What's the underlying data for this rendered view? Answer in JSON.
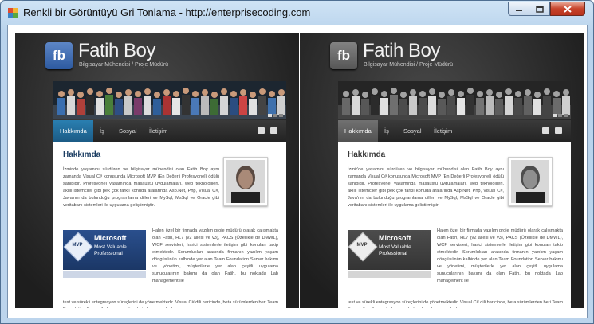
{
  "window": {
    "title": "Renkli bir Görüntüyü Gri Tonlama - http://enterprisecoding.com",
    "controls": [
      "minimize",
      "maximize",
      "close"
    ]
  },
  "page": {
    "logo_text": "fb",
    "site_title": "Fatih Boy",
    "site_subtitle": "Bilgisayar Mühendisi / Proje Müdürü",
    "nav": [
      "Hakkımda",
      "İş",
      "Sosyal",
      "İletişim"
    ],
    "active_nav": "Hakkımda",
    "section_title": "Hakkımda",
    "para1": "İzmir'de yaşamını sürdüren ve bilgisayar mühendisi olan Fatih Boy aynı zamanda Visual C# konusunda Microsoft MVP (En Değerli Profesyonel) ödülü sahibidir. Profesyonel yaşamında masaüstü uygulamaları, web teknolojileri, akıllı istemciler gibi pek çok farklı konuda aralarında Asp.Net, Php, Visual C#, Java'nın da bulunduğu programlama dilleri ve MySql, MsSql ve Oracle gibi veritabanı sistemleri ile uygulama geliştirmiştir.",
    "para2": "Halen özel bir firmada yazılım proje müdürü olarak çalışmakta olan Fatih, HL7 (v2 ailesi ve v3), PACS (Özellikle de DMWL), WCF servisleri, harici sistemlerle iletişim gibi konuları takip etmektedir. Sorumlukları arasında firmanın yazılım yaşam döngüsünün kalbinde yer alan Team Foundation Server bakımı ve yönetimi, müşterilerle yer alan çeşitli uygulama sunucularının bakımı da olan Fatih, bu noktada Lab management ile",
    "para3": "test ve sürekli entegrasyon süreçlerini de yönetmektedir. Visual C# dili haricinde, beta sürümlerden beri Team Foundation Server ile kurumsal süreçlerinde ve yazılımlar.",
    "mvp": {
      "diamond_text": "MVP",
      "line1": "Microsoft",
      "line2": "Most Valuable",
      "line3": "Professional"
    },
    "colors": {
      "accent": "#1b5a84",
      "heading": "#1c3e63",
      "background": "#2b2b2b"
    }
  }
}
